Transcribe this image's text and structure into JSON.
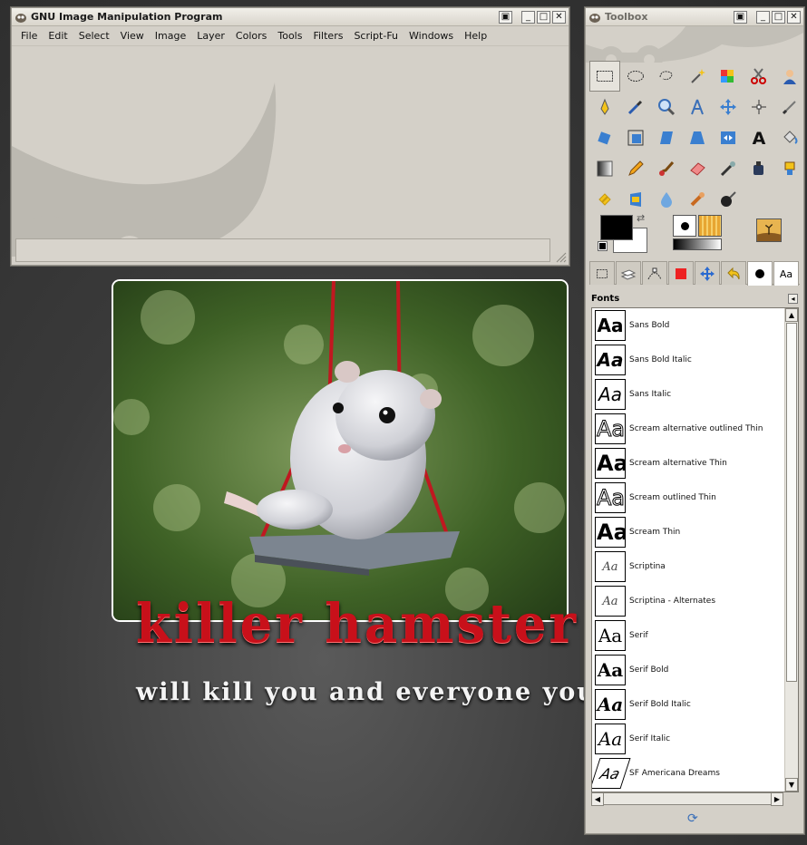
{
  "main_window": {
    "title": "GNU Image Manipulation Program",
    "menu": [
      "File",
      "Edit",
      "Select",
      "View",
      "Image",
      "Layer",
      "Colors",
      "Tools",
      "Filters",
      "Script-Fu",
      "Windows",
      "Help"
    ]
  },
  "window_buttons": {
    "menu": "▣",
    "minimize": "_",
    "maximize": "□",
    "close": "✕"
  },
  "poster": {
    "title": "killer hamster",
    "subtitle": "will kill you and everyone you love"
  },
  "toolbox": {
    "title": "Toolbox",
    "tools": [
      "rect-select-icon",
      "ellipse-select-icon",
      "free-select-icon",
      "fuzzy-select-icon",
      "select-by-color-icon",
      "scissors-icon",
      "foreground-select-icon",
      "paths-icon",
      "color-picker-icon",
      "zoom-icon",
      "measure-icon",
      "move-icon",
      "align-icon",
      "crop-icon",
      "rotate-icon",
      "scale-icon",
      "shear-icon",
      "perspective-icon",
      "flip-icon",
      "text-icon",
      "bucket-fill-icon",
      "blend-icon",
      "pencil-icon",
      "paintbrush-icon",
      "eraser-icon",
      "airbrush-icon",
      "ink-icon",
      "clone-icon",
      "heal-icon",
      "perspective-clone-icon",
      "blur-icon",
      "smudge-icon",
      "dodge-burn-icon"
    ],
    "colors": {
      "foreground": "#000000",
      "background": "#ffffff"
    },
    "dock_tabs": [
      "tool-options-tab",
      "layers-tab",
      "paths-tab",
      "channels-tab",
      "navigation-tab",
      "undo-tab",
      "brushes-tab",
      "fonts-tab"
    ],
    "fonts_panel_title": "Fonts",
    "preview_text": "Aa",
    "fonts": [
      "Sans Bold",
      "Sans Bold Italic",
      "Sans Italic",
      "Scream alternative outlined Thin",
      "Scream alternative Thin",
      "Scream outlined Thin",
      "Scream Thin",
      "Scriptina",
      "Scriptina - Alternates",
      "Serif",
      "Serif Bold",
      "Serif Bold Italic",
      "Serif Italic",
      "SF Americana Dreams"
    ],
    "refresh_glyph": "⟳"
  }
}
